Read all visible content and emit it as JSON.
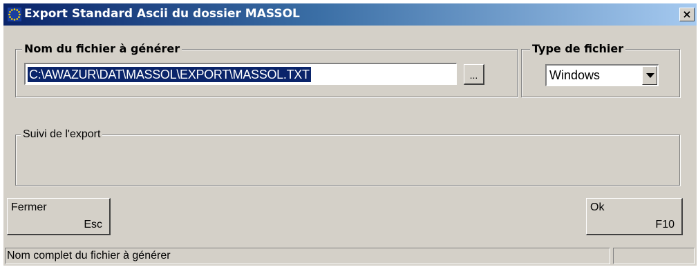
{
  "window": {
    "title": "Export Standard Ascii du dossier MASSOL",
    "close_label": "×",
    "icon": "eu-stars-icon"
  },
  "filename_group": {
    "label": "Nom du fichier à générer",
    "value": "C:\\AWAZUR\\DAT\\MASSOL\\EXPORT\\MASSOL.TXT",
    "browse_label": "..."
  },
  "filetype_group": {
    "label": "Type de fichier",
    "selected": "Windows"
  },
  "progress_group": {
    "label": "Suivi de l'export"
  },
  "buttons": {
    "close_label": "Fermer",
    "close_key": "Esc",
    "ok_label": "Ok",
    "ok_key": "F10"
  },
  "statusbar": {
    "text": "Nom complet du fichier à générer",
    "secondary": ""
  },
  "colors": {
    "face": "#d4d0c8",
    "title_start": "#0a246a",
    "title_end": "#a6caf0",
    "selection": "#0a246a"
  }
}
